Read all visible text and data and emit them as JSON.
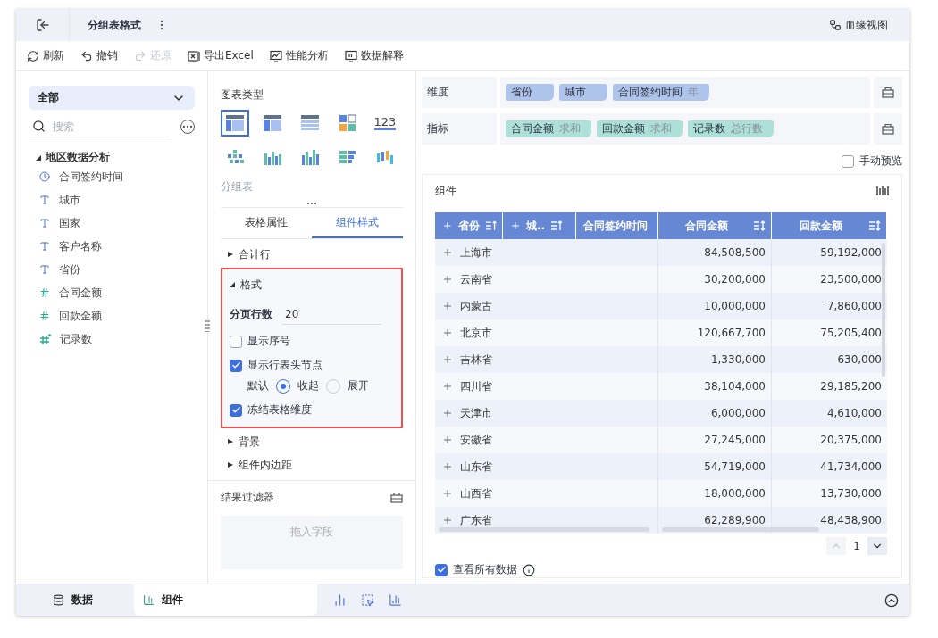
{
  "window": {
    "title": "分组表格式",
    "header_link": "血缘视图"
  },
  "toolbar": [
    {
      "label": "刷新",
      "disabled": false
    },
    {
      "label": "撤销",
      "disabled": false
    },
    {
      "label": "还原",
      "disabled": true
    },
    {
      "label": "导出Excel",
      "disabled": false
    },
    {
      "label": "性能分析",
      "disabled": false
    },
    {
      "label": "数据解释",
      "disabled": false
    }
  ],
  "fields": {
    "scope": "全部",
    "search_placeholder": "搜索",
    "tree": {
      "label": "地区数据分析",
      "expanded": true,
      "children": [
        {
          "label": "合同签约时间",
          "kind": "time"
        },
        {
          "label": "城市",
          "kind": "text"
        },
        {
          "label": "国家",
          "kind": "text"
        },
        {
          "label": "客户名称",
          "kind": "text"
        },
        {
          "label": "省份",
          "kind": "text"
        },
        {
          "label": "合同金额",
          "kind": "number"
        },
        {
          "label": "回款金额",
          "kind": "number"
        },
        {
          "label": "记录数",
          "kind": "calc"
        }
      ]
    }
  },
  "config": {
    "chart_type_title": "图表类型",
    "chart_types": [
      {
        "kind": "group",
        "selected": true
      },
      {
        "kind": "cross",
        "selected": false
      },
      {
        "kind": "detail",
        "selected": false
      },
      {
        "kind": "blocks",
        "selected": false
      },
      {
        "kind": "number",
        "text": "123",
        "selected": false
      },
      {
        "kind": "dots",
        "selected": false
      },
      {
        "kind": "bars",
        "selected": false
      },
      {
        "kind": "bars2",
        "selected": false
      },
      {
        "kind": "hbars",
        "selected": false
      },
      {
        "kind": "waterfall",
        "selected": false
      }
    ],
    "chart_type_name": "分组表",
    "tabs": [
      {
        "label": "表格属性",
        "selected": false
      },
      {
        "label": "组件样式",
        "selected": true
      }
    ],
    "sections": [
      {
        "label": "合计行",
        "expanded": false,
        "highlighted": false
      },
      {
        "label": "格式",
        "expanded": true,
        "highlighted": true,
        "page_rows": {
          "label": "分页行数",
          "value": "20"
        },
        "options": [
          {
            "kind": "checkbox",
            "label": "显示序号",
            "checked": false
          },
          {
            "kind": "checkbox",
            "label": "显示行表头节点",
            "checked": true
          },
          {
            "kind": "radio",
            "label": "默认",
            "choices": [
              {
                "label": "收起",
                "selected": true
              },
              {
                "label": "展开",
                "selected": false
              }
            ]
          },
          {
            "kind": "checkbox",
            "label": "冻结表格维度",
            "checked": true
          }
        ]
      },
      {
        "label": "背景",
        "expanded": false,
        "highlighted": false
      },
      {
        "label": "组件内边距",
        "expanded": false,
        "highlighted": false
      }
    ],
    "filter": {
      "title": "结果过滤器",
      "placeholder": "拖入字段"
    }
  },
  "shelves": [
    {
      "label": "维度",
      "kind": "dimension",
      "pills": [
        {
          "name": "省份"
        },
        {
          "name": "城市"
        },
        {
          "name": "合同签约时间",
          "agg": "年"
        }
      ]
    },
    {
      "label": "指标",
      "kind": "metric",
      "pills": [
        {
          "name": "合同金额",
          "agg": "求和"
        },
        {
          "name": "回款金额",
          "agg": "求和"
        },
        {
          "name": "记录数",
          "agg": "总行数"
        }
      ]
    }
  ],
  "manual_preview": {
    "label": "手动预览",
    "checked": false
  },
  "component": {
    "title": "组件",
    "columns": [
      {
        "label": "省份",
        "kind": "dimension",
        "expandable": true
      },
      {
        "label": "城..",
        "kind": "dimension",
        "expandable": true
      },
      {
        "label": "合同签约时间",
        "kind": "dimension",
        "expandable": false
      },
      {
        "label": "合同金额",
        "kind": "measure",
        "expandable": false
      },
      {
        "label": "回款金额",
        "kind": "measure",
        "expandable": false
      }
    ],
    "rows": [
      {
        "name": "上海市",
        "contract": "84,508,500",
        "payment": "59,192,000"
      },
      {
        "name": "云南省",
        "contract": "30,200,000",
        "payment": "23,500,000"
      },
      {
        "name": "内蒙古",
        "contract": "10,000,000",
        "payment": "7,860,000"
      },
      {
        "name": "北京市",
        "contract": "120,667,700",
        "payment": "75,205,400"
      },
      {
        "name": "吉林省",
        "contract": "1,330,000",
        "payment": "630,000"
      },
      {
        "name": "四川省",
        "contract": "38,104,000",
        "payment": "29,185,200"
      },
      {
        "name": "天津市",
        "contract": "6,000,000",
        "payment": "4,610,000"
      },
      {
        "name": "安徽省",
        "contract": "27,245,000",
        "payment": "20,375,000"
      },
      {
        "name": "山东省",
        "contract": "54,719,000",
        "payment": "41,734,000"
      },
      {
        "name": "山西省",
        "contract": "18,000,000",
        "payment": "13,730,000"
      },
      {
        "name": "广东省",
        "contract": "62,289,900",
        "payment": "48,438,900"
      }
    ],
    "page": "1",
    "view_all": {
      "label": "查看所有数据",
      "checked": true
    }
  },
  "bottom_tabs": [
    {
      "label": "数据",
      "selected": false
    },
    {
      "label": "组件",
      "selected": true
    }
  ]
}
